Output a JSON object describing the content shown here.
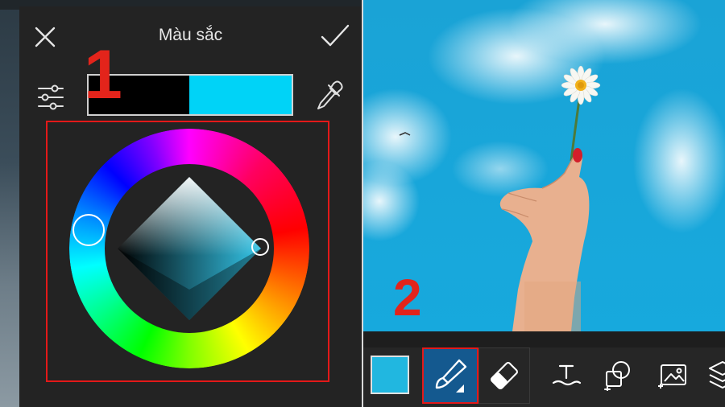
{
  "dialog": {
    "title": "Màu sắc",
    "close_icon": "close-icon",
    "confirm_icon": "checkmark-icon",
    "settings_icon": "sliders-icon",
    "eyedropper_icon": "eyedropper-icon",
    "previous_color": "#000000",
    "current_color": "#00d3f7"
  },
  "annotations": {
    "step1": "1",
    "step2": "2",
    "highlight_color": "#e31919"
  },
  "toolbar": {
    "color_swatch": "#21b7e0",
    "tools": [
      "brush-icon",
      "eraser-icon",
      "text-icon",
      "add-shape-icon",
      "add-image-icon",
      "layers-icon"
    ]
  }
}
